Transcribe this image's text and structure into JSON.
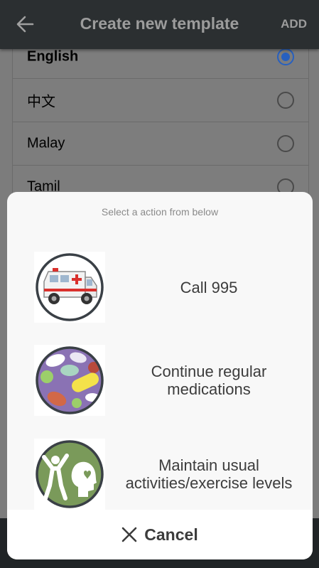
{
  "appbar": {
    "title": "Create new template",
    "add_label": "ADD",
    "back_icon": "arrow-left-icon"
  },
  "languages": [
    {
      "label": "English",
      "selected": true
    },
    {
      "label": "中文",
      "selected": false
    },
    {
      "label": "Malay",
      "selected": false
    },
    {
      "label": "Tamil",
      "selected": false
    }
  ],
  "sheet": {
    "prompt": "Select a action from below",
    "actions": [
      {
        "label": "Call 995",
        "icon": "ambulance-icon"
      },
      {
        "label": "Continue regular medications",
        "icon": "medications-icon"
      },
      {
        "label": "Maintain usual activities/exercise levels",
        "icon": "activity-exercise-icon"
      }
    ],
    "cancel_label": "Cancel",
    "cancel_icon": "close-icon"
  },
  "colors": {
    "appbar_bg": "#2b2f31",
    "accent": "#2760c0",
    "sheet_bg": "#f8f8f8",
    "text": "#3c3c3c"
  }
}
